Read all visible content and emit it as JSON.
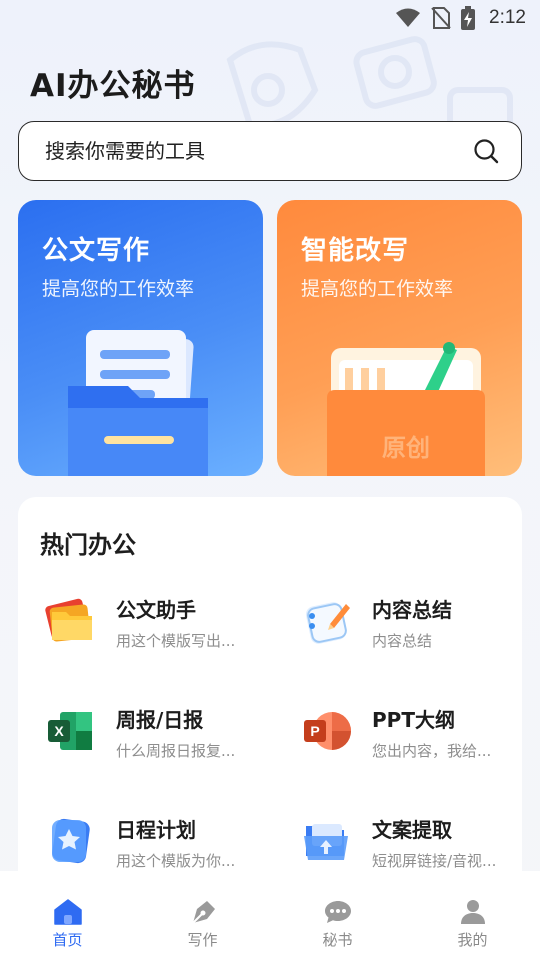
{
  "status_bar": {
    "time": "2:12",
    "icons": [
      "wifi-icon",
      "no-sim-icon",
      "battery-charging-icon"
    ]
  },
  "app": {
    "title": "AI办公秘书"
  },
  "search": {
    "placeholder": "搜索你需要的工具",
    "icon": "search-icon"
  },
  "feature_cards": [
    {
      "title": "公文写作",
      "subtitle": "提高您的工作效率",
      "color": "#3a7ff3"
    },
    {
      "title": "智能改写",
      "subtitle": "提高您的工作效率",
      "color": "#ff9447",
      "badge": "原创"
    }
  ],
  "hot_section": {
    "title": "热门办公",
    "tools": [
      {
        "name": "公文助手",
        "desc": "用这个模版写出...",
        "icon": "folders-icon"
      },
      {
        "name": "内容总结",
        "desc": "内容总结",
        "icon": "notebook-icon"
      },
      {
        "name": "周报/日报",
        "desc": "什么周报日报复...",
        "icon": "excel-icon"
      },
      {
        "name": "PPT大纲",
        "desc": "您出内容，我给...",
        "icon": "powerpoint-icon"
      },
      {
        "name": "日程计划",
        "desc": "用这个模版为你...",
        "icon": "star-card-icon"
      },
      {
        "name": "文案提取",
        "desc": "短视屏链接/音视...",
        "icon": "upload-folder-icon"
      }
    ]
  },
  "bottom_nav": [
    {
      "label": "首页",
      "icon": "home-icon",
      "active": true
    },
    {
      "label": "写作",
      "icon": "pen-icon",
      "active": false
    },
    {
      "label": "秘书",
      "icon": "chat-icon",
      "active": false
    },
    {
      "label": "我的",
      "icon": "user-icon",
      "active": false
    }
  ],
  "colors": {
    "accent": "#2f6bf2",
    "inactive": "#8a8a8a"
  }
}
